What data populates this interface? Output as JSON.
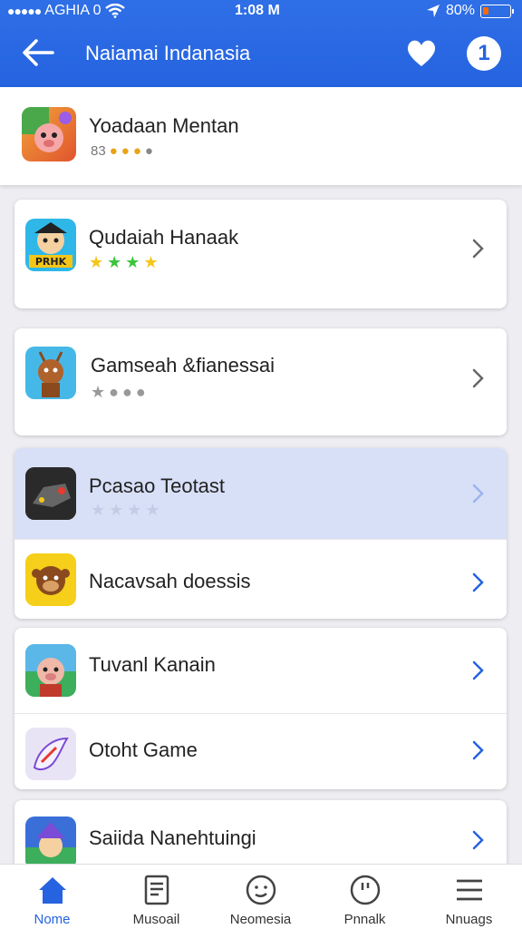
{
  "status_bar": {
    "carrier": "AGHIA 0",
    "time": "1:08 M",
    "battery": "80%"
  },
  "header": {
    "title": "Naiamai Indanasia",
    "badge_count": "1"
  },
  "top_item": {
    "title": "Yoadaan Mentan",
    "rating_label": "83"
  },
  "items": [
    {
      "title": "Qudaiah Hanaak",
      "icon": "pirate-game-icon",
      "icon_text": "PRHK"
    },
    {
      "title": "Gamseah &fianessai",
      "icon": "deer-game-icon"
    },
    {
      "title": "Pcasao Teotast",
      "icon": "controller-game-icon"
    },
    {
      "title": "Nacavsah doessis",
      "icon": "monkey-game-icon"
    },
    {
      "title": "Tuvanl Kanain",
      "icon": "pig-game-icon"
    },
    {
      "title": "Otoht Game",
      "icon": "wing-game-icon"
    },
    {
      "title": "Saiida Nanehtuingi",
      "icon": "wizard-game-icon"
    }
  ],
  "tabbar": {
    "tabs": [
      {
        "label": "Nome",
        "icon": "home-icon"
      },
      {
        "label": "Musoail",
        "icon": "document-icon"
      },
      {
        "label": "Neomesia",
        "icon": "smiley-icon"
      },
      {
        "label": "Pnnalk",
        "icon": "clock-icon"
      },
      {
        "label": "Nnuags",
        "icon": "menu-icon"
      }
    ]
  },
  "colors": {
    "brand_blue": "#2563e0",
    "highlight": "#d8e0f8",
    "star_gold": "#e8a317",
    "star_green": "#3cc43c"
  }
}
